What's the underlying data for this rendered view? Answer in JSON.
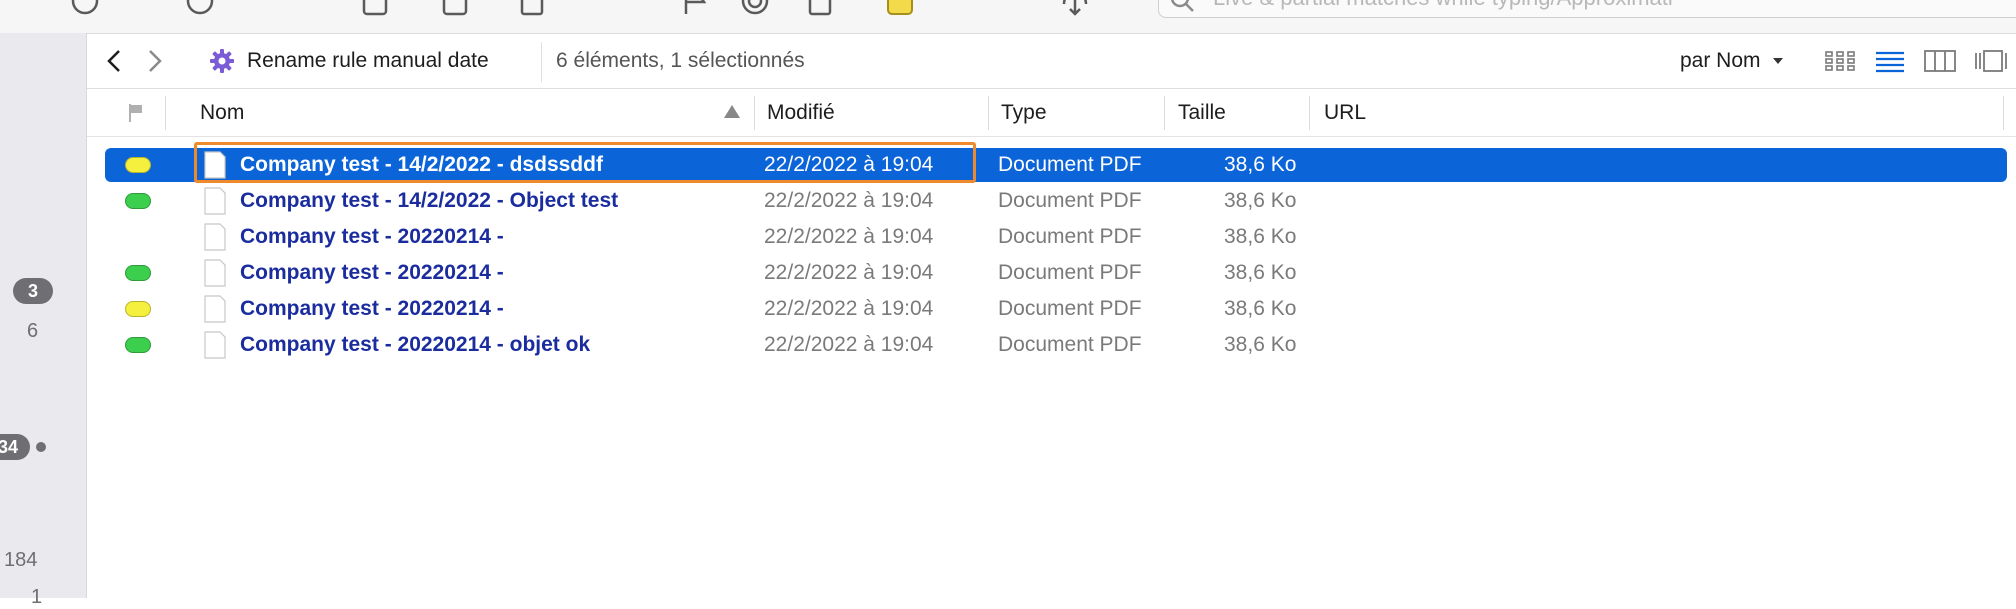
{
  "toolbar": {
    "search_placeholder": "Live & partial matches while typing/Approximati"
  },
  "sidebar": {
    "badge_top": "3",
    "count_top": "6",
    "badge_mid": "34",
    "count_bottom": "184",
    "count_cut": "1"
  },
  "pathbar": {
    "title": "Rename rule manual date",
    "count": "6 éléments, 1 sélectionnés",
    "sort_label": "par Nom"
  },
  "columns": {
    "name": "Nom",
    "modified": "Modifié",
    "type": "Type",
    "size": "Taille",
    "url": "URL"
  },
  "colors": {
    "selection": "#0b64d8",
    "highlight_border": "#ef8a2c",
    "name_text": "#1b2d9e",
    "label_yellow": "#f5ef3e",
    "label_green": "#3ccf4e"
  },
  "rows": [
    {
      "label": "yellow",
      "name": "Company test - 14/2/2022 - dsdssddf",
      "modified": "22/2/2022 à 19:04",
      "type": "Document PDF",
      "size": "38,6 Ko",
      "selected": true
    },
    {
      "label": "green",
      "name": "Company test - 14/2/2022 - Object test",
      "modified": "22/2/2022 à 19:04",
      "type": "Document PDF",
      "size": "38,6 Ko",
      "selected": false
    },
    {
      "label": "none",
      "name": "Company test - 20220214 -",
      "modified": "22/2/2022 à 19:04",
      "type": "Document PDF",
      "size": "38,6 Ko",
      "selected": false
    },
    {
      "label": "green",
      "name": "Company test - 20220214 -",
      "modified": "22/2/2022 à 19:04",
      "type": "Document PDF",
      "size": "38,6 Ko",
      "selected": false
    },
    {
      "label": "yellow",
      "name": "Company test - 20220214 -",
      "modified": "22/2/2022 à 19:04",
      "type": "Document PDF",
      "size": "38,6 Ko",
      "selected": false
    },
    {
      "label": "green",
      "name": "Company test - 20220214 - objet ok",
      "modified": "22/2/2022 à 19:04",
      "type": "Document PDF",
      "size": "38,6 Ko",
      "selected": false
    }
  ]
}
